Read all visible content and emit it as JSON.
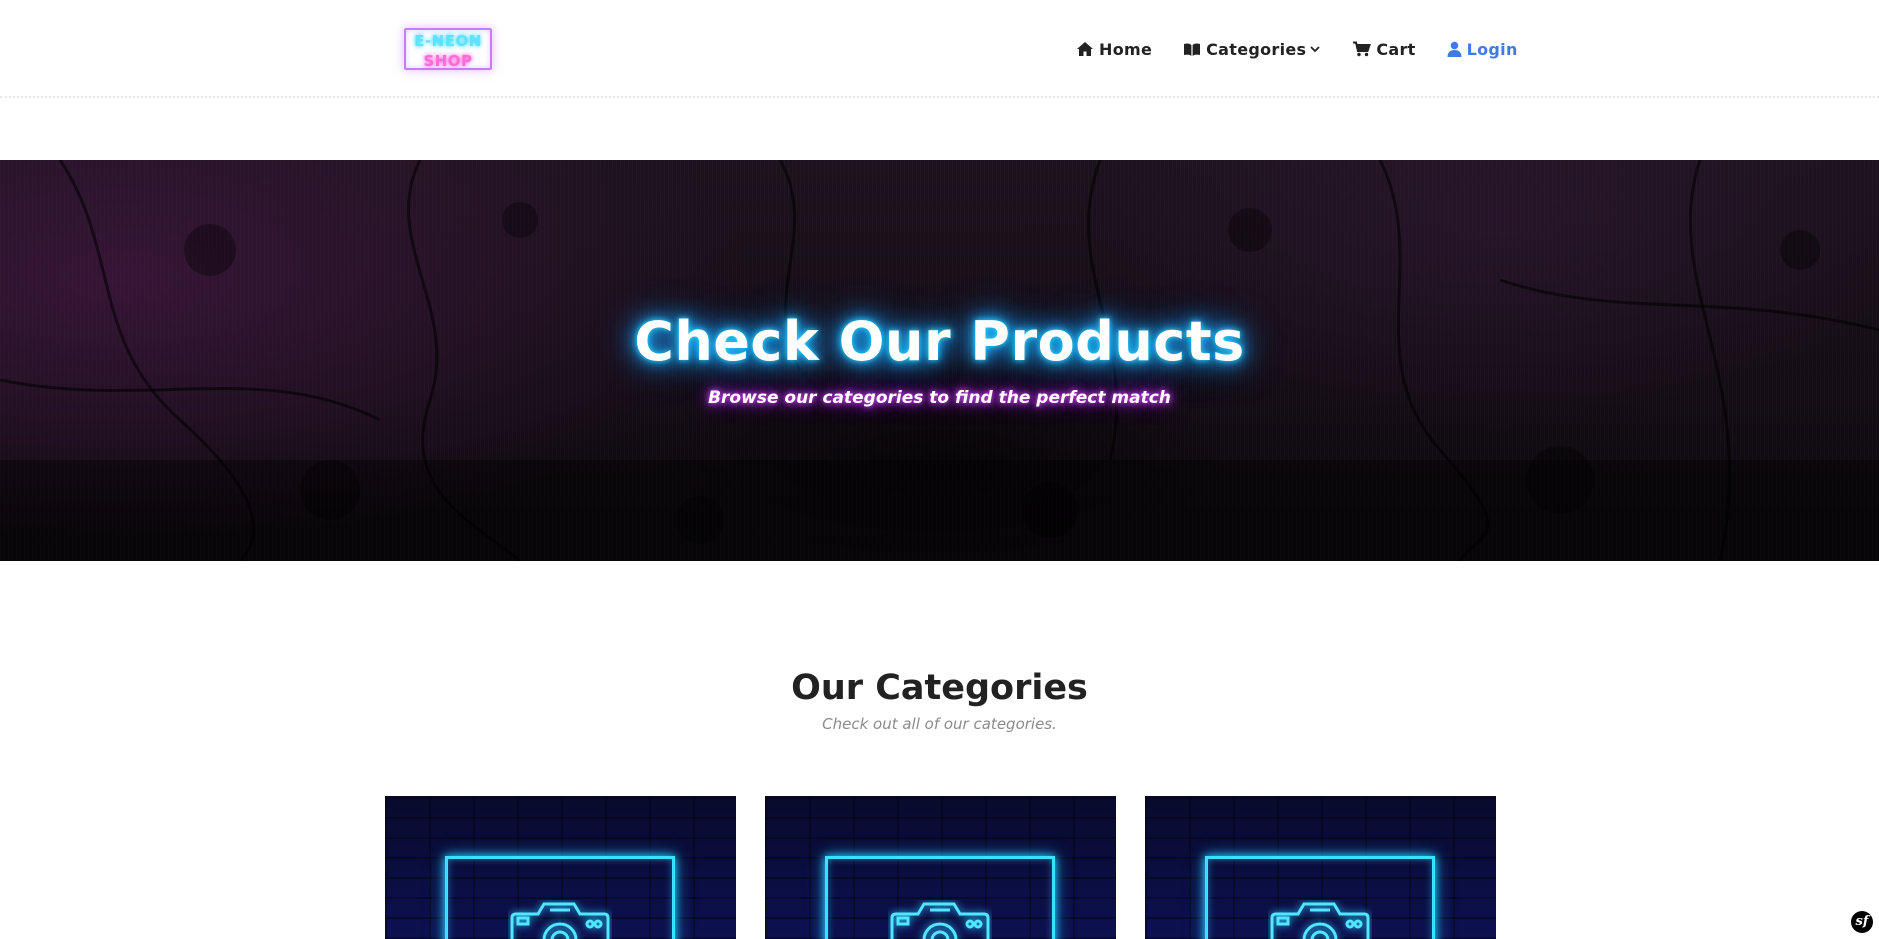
{
  "header": {
    "logo": {
      "line1": "E-NEON",
      "line2": "SHOP"
    },
    "nav": [
      {
        "label": "Home",
        "icon": "home-icon"
      },
      {
        "label": "Categories",
        "icon": "book-open-icon",
        "dropdown": true
      },
      {
        "label": "Cart",
        "icon": "cart-icon"
      },
      {
        "label": "Login",
        "icon": "user-icon"
      }
    ]
  },
  "hero": {
    "title": "Check Our Products",
    "subtitle": "Browse our categories to find the perfect match"
  },
  "categories": {
    "title": "Our Categories",
    "subtitle": "Check out all of our categories.",
    "cards": [
      {
        "icon": "camera-icon"
      },
      {
        "icon": "camera-icon"
      },
      {
        "icon": "camera-icon"
      }
    ]
  },
  "colors": {
    "accent_login": "#3f7be6",
    "neon_cyan": "#39e0ff",
    "neon_pink": "#ff6bd6",
    "neon_purple": "#c77dff"
  },
  "debug_toolbar": {
    "icon": "symfony-icon",
    "glyph": "sf"
  }
}
